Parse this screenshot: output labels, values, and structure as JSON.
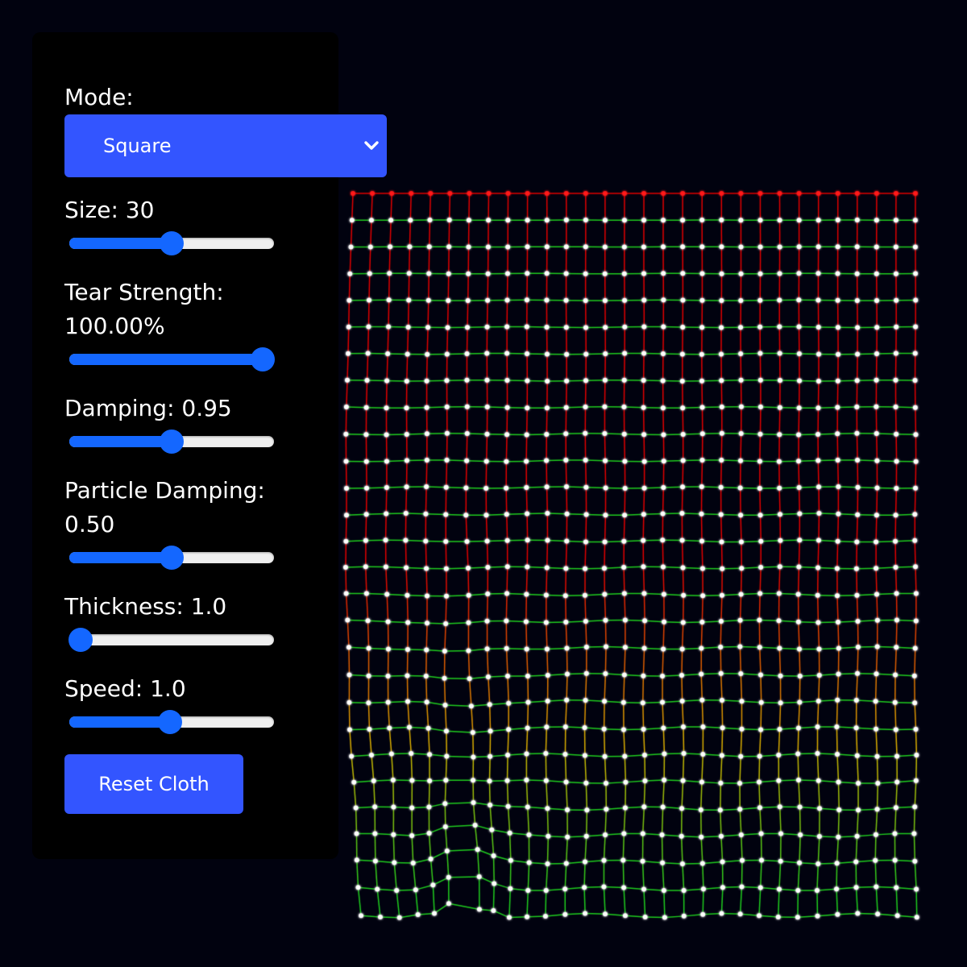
{
  "controls": {
    "mode": {
      "label": "Mode:",
      "selected": "Square",
      "icon": "chevron-down-icon"
    },
    "size": {
      "label": "Size: 30",
      "value": 30,
      "fraction": 0.5
    },
    "tear_strength": {
      "label_line1": "Tear Strength:",
      "label_line2": "100.00%",
      "fraction": 1.0
    },
    "damping": {
      "label": "Damping: 0.95",
      "fraction": 0.5
    },
    "particle_damping": {
      "label_line1": "Particle Damping:",
      "label_line2": "0.50",
      "fraction": 0.5
    },
    "thickness": {
      "label": "Thickness: 1.0",
      "fraction": 0.0
    },
    "speed": {
      "label": "Speed: 1.0",
      "fraction": 0.49
    },
    "reset_label": "Reset Cloth"
  },
  "cloth": {
    "columns": 30,
    "rows": 28,
    "colors": {
      "pinned_point": "#ff1a1a",
      "point": "#ffffff",
      "strained_link": "#e00000",
      "mid_link": "#d9b400",
      "relaxed_link": "#1fcc1f"
    }
  },
  "colors": {
    "background": "#01020f",
    "panel": "#000000",
    "accent": "#3355ff",
    "slider": "#1467ff"
  }
}
